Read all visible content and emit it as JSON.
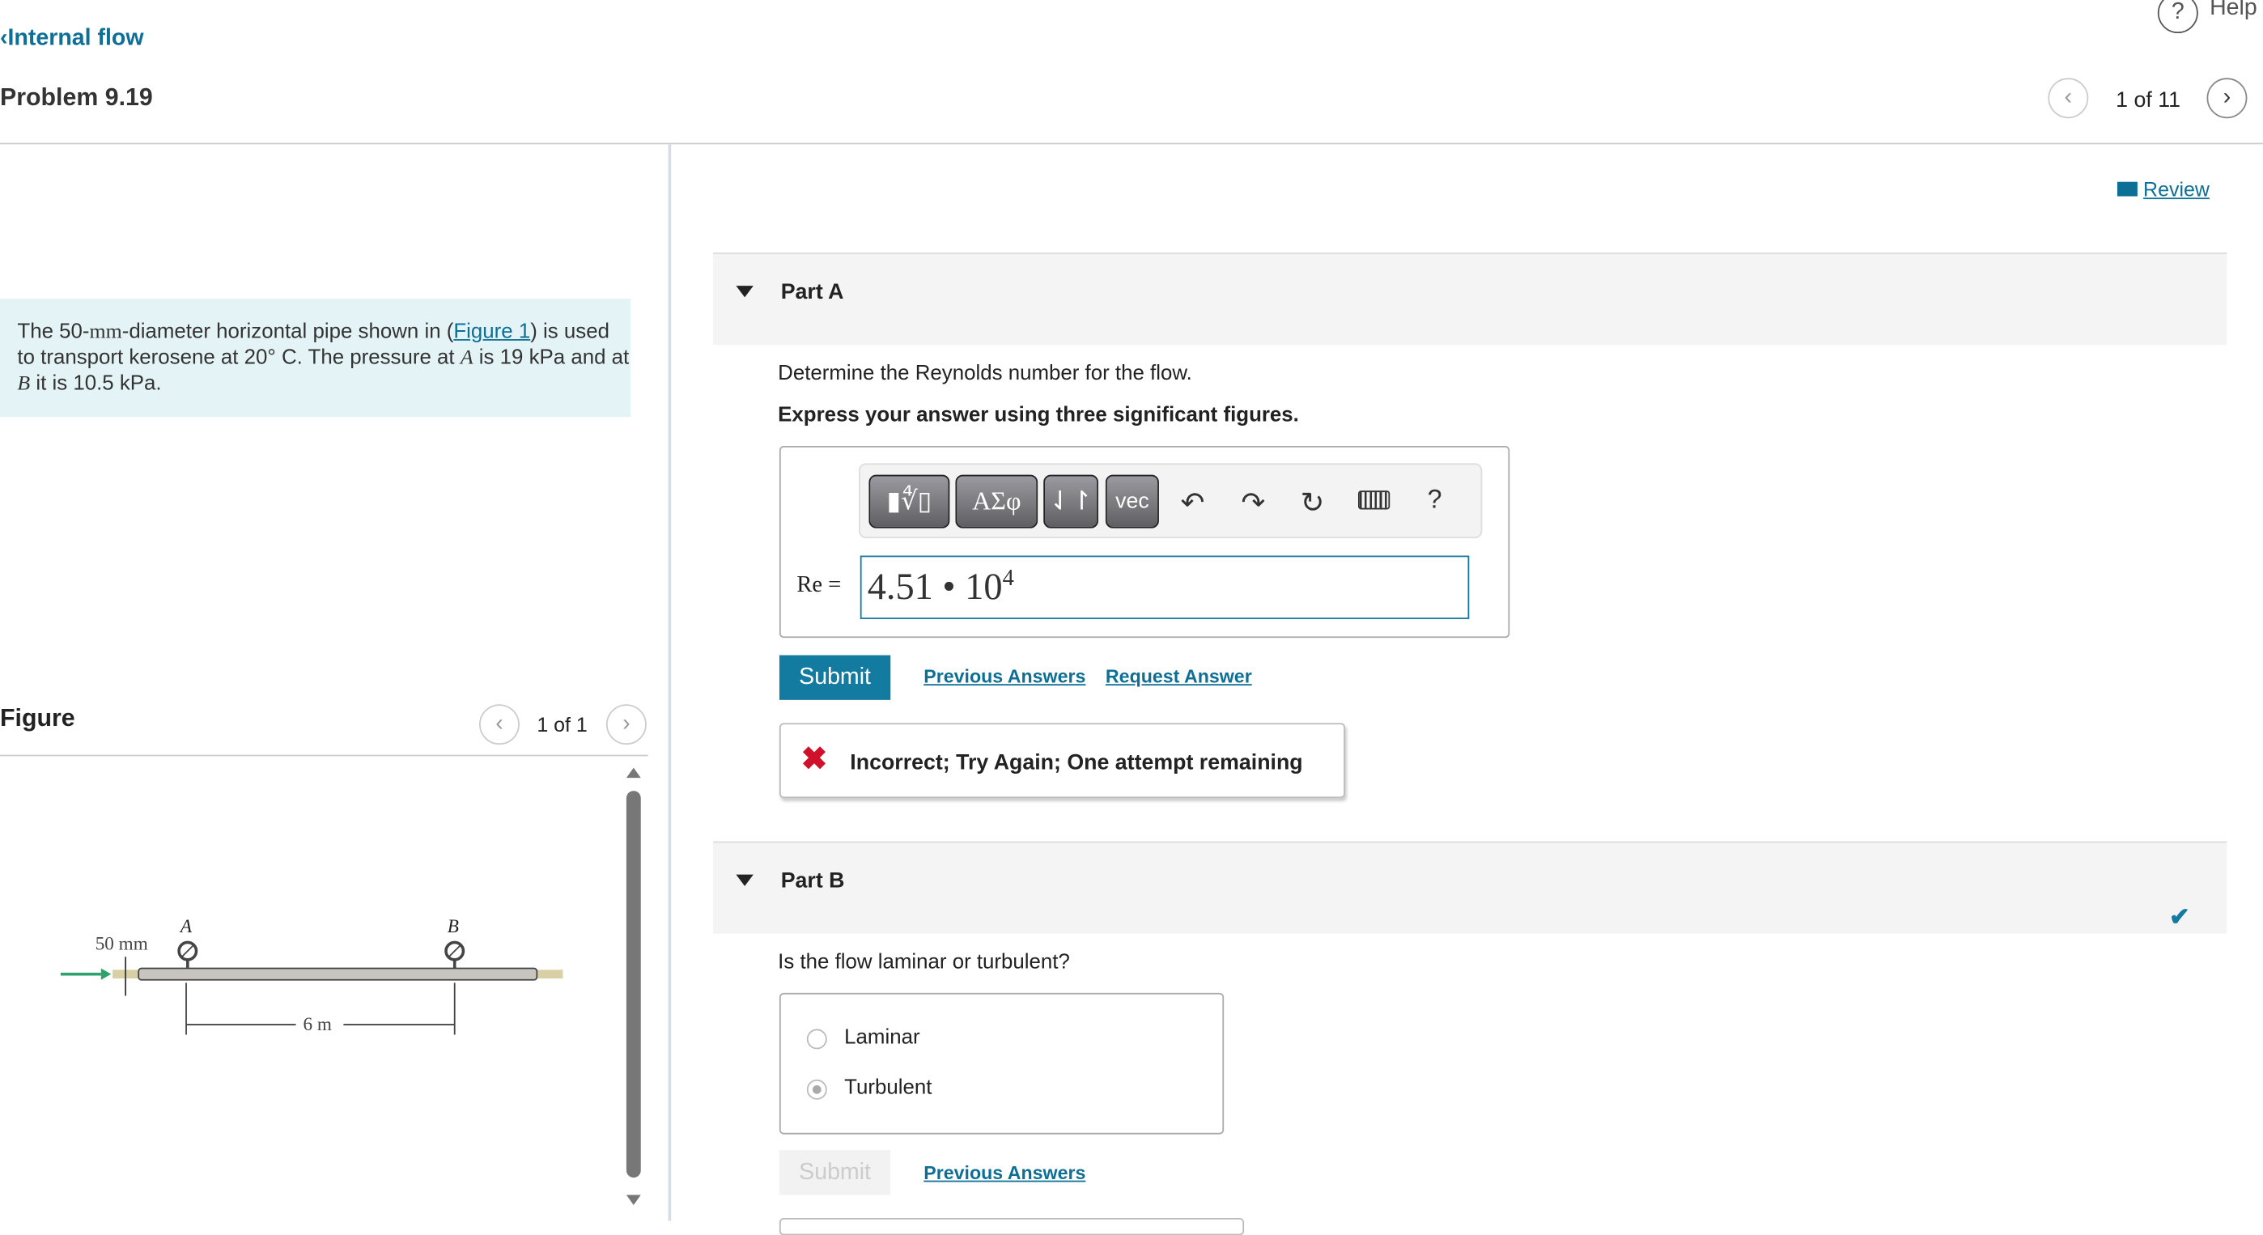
{
  "nav": {
    "back_label": "Internal flow",
    "help_label": "Help",
    "problem_title": "Problem 9.19",
    "pagination": "1 of 11",
    "review_label": "Review"
  },
  "problem": {
    "text_before": "The 50-",
    "unit_mm": "mm",
    "text_mid": "-diameter horizontal pipe shown in (",
    "figure_link": "Figure 1",
    "text_after": ") is used to transport kerosene at 20° C. The pressure at ",
    "A": "A",
    "text2": " is 19 kPa and at ",
    "B": "B",
    "text3": " it is 10.5 kPa."
  },
  "figure": {
    "heading": "Figure",
    "pagination": "1 of 1",
    "label_diameter": "50 mm",
    "label_a": "A",
    "label_b": "B",
    "label_length": "6 m"
  },
  "partA": {
    "title": "Part A",
    "question": "Determine the Reynolds number for the flow.",
    "instruction": "Express your answer using three significant figures.",
    "toolbar": {
      "templates": "▮∜▯",
      "greek": "ΑΣφ",
      "arrows": "⇃↾",
      "vec": "vec",
      "help": "?"
    },
    "var_label": "Re =",
    "answer_mantissa": "4.51 • 10",
    "answer_exponent": "4",
    "submit": "Submit",
    "previous_answers": "Previous Answers",
    "request_answer": "Request Answer",
    "feedback": "Incorrect; Try Again; One attempt remaining"
  },
  "partB": {
    "title": "Part B",
    "question": "Is the flow laminar or turbulent?",
    "options": [
      "Laminar",
      "Turbulent"
    ],
    "selected": "Turbulent",
    "submit": "Submit",
    "previous_answers": "Previous Answers"
  },
  "colors": {
    "accent": "#137aa0",
    "error": "#d0112b",
    "problem_bg": "#e4f4f6"
  }
}
